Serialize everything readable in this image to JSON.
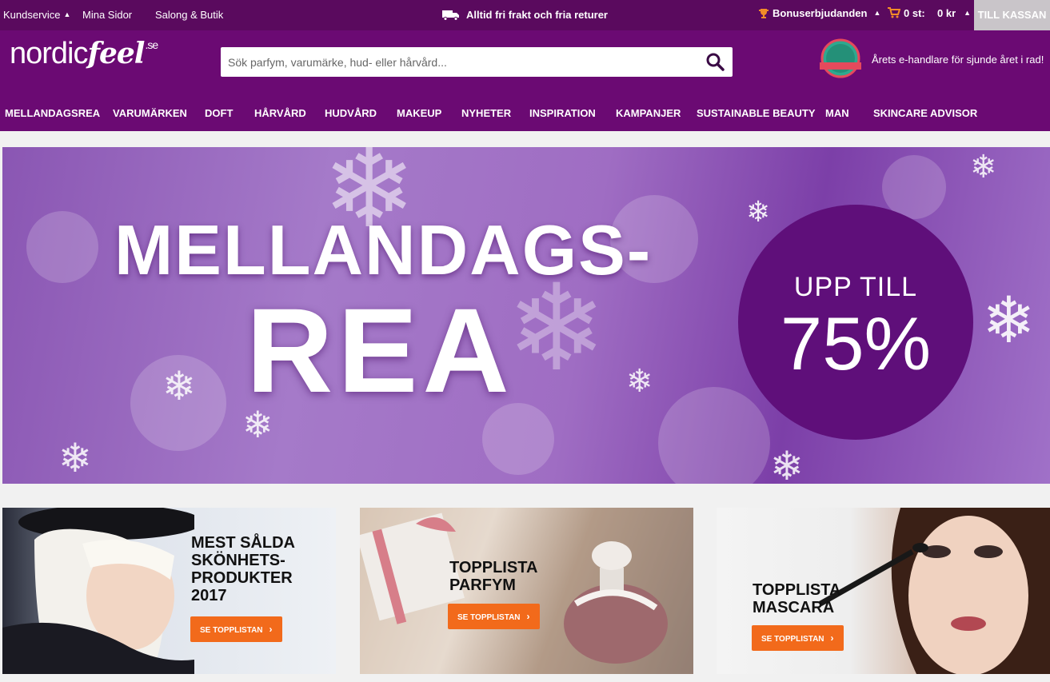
{
  "topbar": {
    "customer_service": "Kundservice",
    "my_pages": "Mina Sidor",
    "salon": "Salong & Butik",
    "promo": "Alltid fri frakt och fria returer",
    "bonus": "Bonuserbjudanden",
    "cart_count": "0 st:",
    "cart_sum": "0 kr",
    "checkout": "TILL KASSAN"
  },
  "header": {
    "logo_nordic": "nordic",
    "logo_feel": "feel",
    "logo_tld": ".se",
    "search_placeholder": "Sök parfym, varumärke, hud- eller hårvård...",
    "award_text": "Årets e-handlare för sjunde året i rad!"
  },
  "nav": {
    "items": [
      "MELLANDAGSREA",
      "VARUMÄRKEN",
      "DOFT",
      "HÅRVÅRD",
      "HUDVÅRD",
      "MAKEUP",
      "NYHETER",
      "INSPIRATION",
      "KAMPANJER",
      "SUSTAINABLE BEAUTY",
      "MAN",
      "SKINCARE ADVISOR"
    ]
  },
  "hero": {
    "line1": "MELLANDAGS-",
    "line2": "REA",
    "circle_line1": "UPP TILL",
    "circle_line2": "75%"
  },
  "tiles": [
    {
      "title_lines": [
        "MEST SÅLDA",
        "SKÖNHETS-",
        "PRODUKTER",
        "2017"
      ],
      "button": "SE TOPPLISTAN"
    },
    {
      "title_lines": [
        "TOPPLISTA",
        "PARFYM"
      ],
      "button": "SE TOPPLISTAN"
    },
    {
      "title_lines": [
        "TOPPLISTA",
        "MASCARA"
      ],
      "button": "SE TOPPLISTAN"
    }
  ],
  "colors": {
    "topbar": "#5a0a5e",
    "header": "#6b0a73",
    "accent_orange": "#f26a1b",
    "circle": "#5f0f7a"
  }
}
